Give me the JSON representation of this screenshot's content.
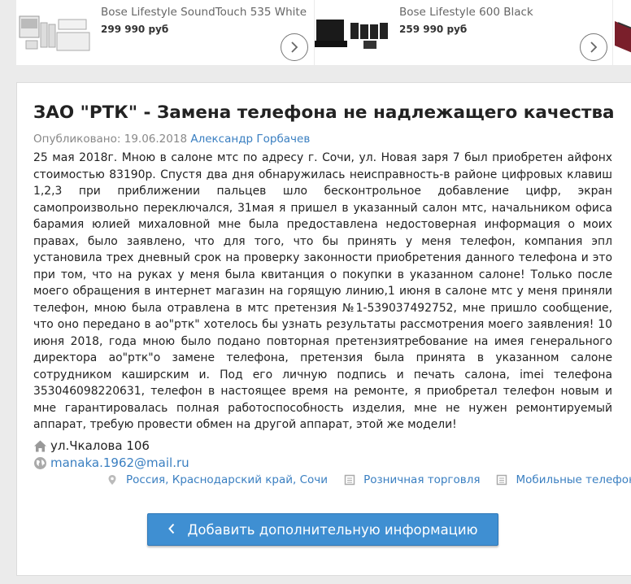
{
  "carousel": {
    "products": [
      {
        "name": "Bose Lifestyle SoundTouch 535 White",
        "price": "299 990 руб"
      },
      {
        "name": "Bose Lifestyle 600 Black",
        "price": "259 990 руб"
      }
    ],
    "next_icon": "chevron-right-icon"
  },
  "article": {
    "title": "ЗАО \"РТК\" - Замена телефона не надлежащего качества",
    "published_label": "Опубликовано: 19.06.2018",
    "author": "Александр Горбачев",
    "body": "25 мая 2018г. Мною в салоне мтс по адресу г. Сочи, ул. Новая заря 7 был приобретен айфонх стоимостью 83190р. Спустя два дня обнаружилась неисправность-в районе цифровых клавиш 1,2,3 при приближении пальцев шло бесконтрольное добавление цифр, экран самопроизвольно переключался, 31мая я пришел в указанный салон мтс, начальником офиса барамия юлией михаловной мне была предоставлена недостоверная информация о моих правах, было заявлено, что для того, что бы принять у меня телефон, компания эпл установила трех дневный срок на проверку законности приобретения данного телефона и это при том, что на руках у меня была квитанция о покупки в указанном салоне! Только после моего обращения в интернет магазин на горящую линию,1 июня в салоне мтс у меня приняли телефон, мною была отравлена в мтс претензия №1-539037492752, мне пришло сообщение, что оно передано в ао\"ртк\" хотелось бы узнать результаты рассмотрения моего заявления! 10 июня 2018, года мною было подано повторная претензиятребование на имея генерального директора ао\"ртк\"о замене телефона, претензия была принята в указанном салоне сотрудником каширским и. Под его личную подпись и печать салона, imei телефона 353046098220631, телефон в настоящее время на ремонте, я приобретал телефон новым и мне гарантировалась полная работоспособность изделия, мне не нужен ремонтируемый аппарат, требую провести обмен на другой аппарат, этой же модели!",
    "address": "ул.Чкалова 106",
    "email": "manaka.1962@mail.ru",
    "location": {
      "country": "Россия",
      "region": "Краснодарский край",
      "city": "Сочи"
    },
    "category1": "Розничная торговля",
    "category2": "Мобильные телефоны",
    "add_button_label": "Добавить дополнительную информацию"
  }
}
